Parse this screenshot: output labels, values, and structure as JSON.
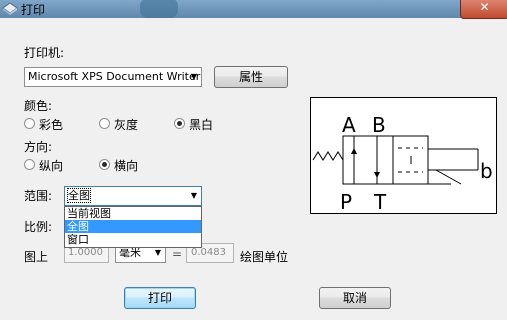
{
  "window": {
    "title": "打印"
  },
  "printer": {
    "label": "打印机:",
    "selected": "Microsoft XPS Document Writer",
    "properties_button": "属性"
  },
  "color": {
    "label": "颜色:",
    "options": [
      {
        "label": "彩色",
        "checked": false
      },
      {
        "label": "灰度",
        "checked": false
      },
      {
        "label": "黑白",
        "checked": true
      }
    ]
  },
  "orientation": {
    "label": "方向:",
    "options": [
      {
        "label": "纵向",
        "checked": false
      },
      {
        "label": "横向",
        "checked": true
      }
    ]
  },
  "range": {
    "label": "范围:",
    "selected": "全图",
    "options": [
      "当前视图",
      "全图",
      "窗口"
    ]
  },
  "scale": {
    "label": "比例:",
    "paper_label": "图上",
    "paper_value": "1.0000",
    "unit": "毫米",
    "equals": "=",
    "drawing_value": "0.0483",
    "drawing_unit_label": "绘图单位"
  },
  "preview": {
    "port_labels": [
      "A",
      "B",
      "P",
      "T",
      "b"
    ]
  },
  "buttons": {
    "print": "打印",
    "cancel": "取消"
  }
}
